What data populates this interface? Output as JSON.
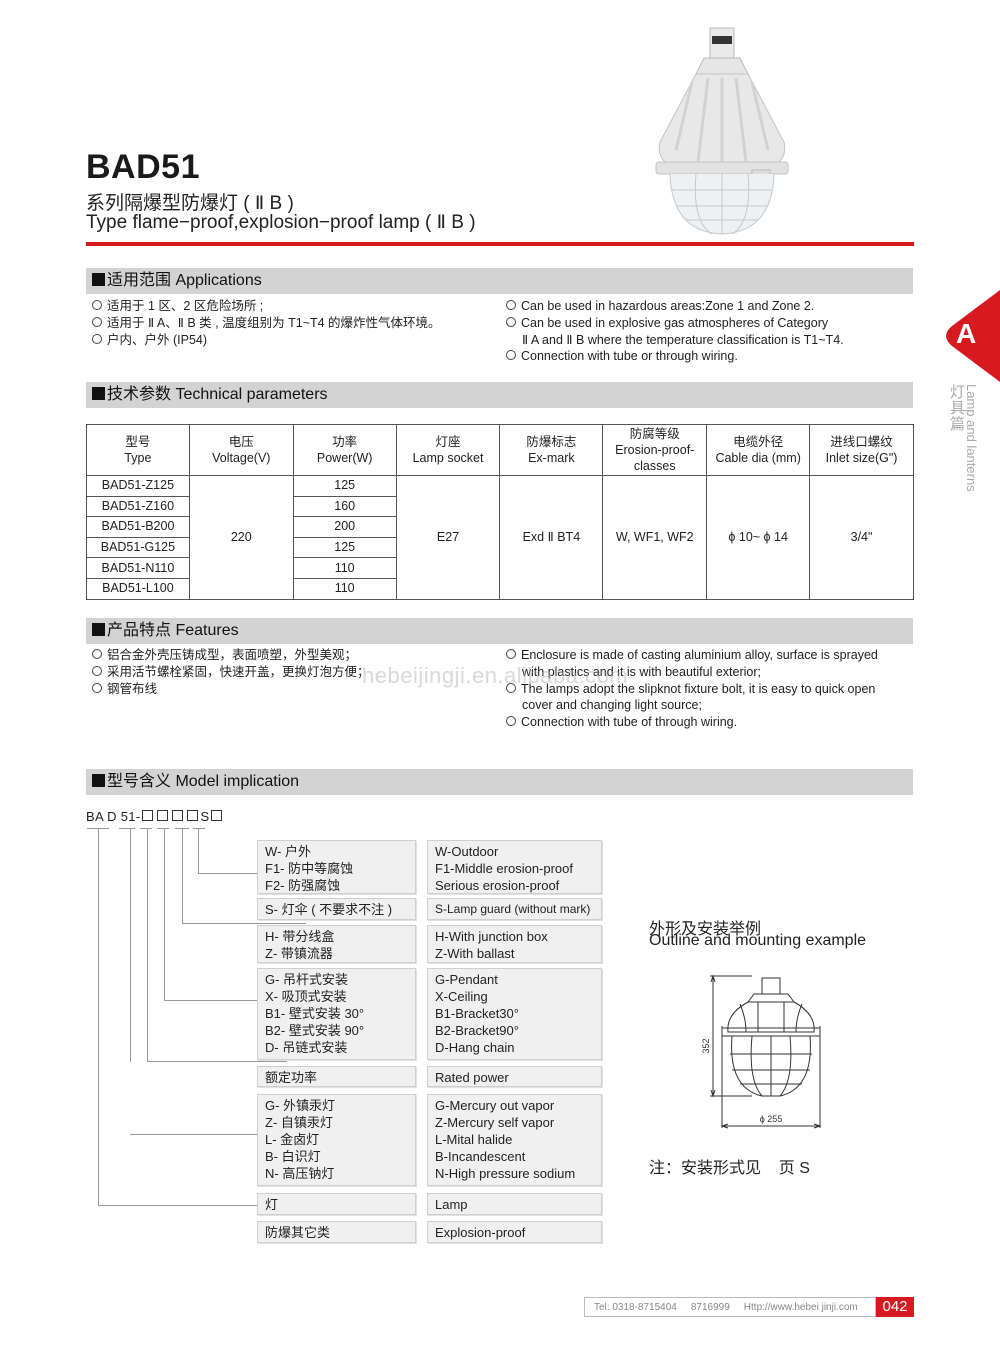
{
  "header": {
    "title": "BAD51",
    "subtitle_cn": "系列隔爆型防爆灯 ( Ⅱ B )",
    "subtitle_en": "Type flame−proof,explosion−proof lamp ( Ⅱ B )",
    "accent_color": "#d71920"
  },
  "side_tab": {
    "letter": "A",
    "label_cn": "灯具篇",
    "label_en": "Lamp and lanterns"
  },
  "applications": {
    "heading": "适用范围 Applications",
    "cn": [
      "适用于 1 区、2 区危险场所 ;",
      "适用于 Ⅱ A、Ⅱ B 类 , 温度组别为 T1~T4 的爆炸性气体环境。",
      "户内、户外 (IP54)"
    ],
    "en": [
      {
        "text": "Can be used in hazardous areas:Zone 1 and Zone 2.",
        "cont": ""
      },
      {
        "text": "Can be used in explosive gas atmospheres of Category",
        "cont": "Ⅱ A and Ⅱ B where the temperature classification is T1~T4."
      },
      {
        "text": "Connection with tube or through wiring.",
        "cont": ""
      }
    ]
  },
  "technical": {
    "heading": "技术参数 Technical parameters",
    "columns": [
      {
        "cn": "型号",
        "en": "Type"
      },
      {
        "cn": "电压",
        "en": "Voltage(V)"
      },
      {
        "cn": "功率",
        "en": "Power(W)"
      },
      {
        "cn": "灯座",
        "en": "Lamp socket"
      },
      {
        "cn": "防爆标志",
        "en": "Ex-mark"
      },
      {
        "cn": "防腐等级",
        "en": "Erosion-proof-classes"
      },
      {
        "cn": "电缆外径",
        "en": "Cable dia (mm)"
      },
      {
        "cn": "进线口螺纹",
        "en": "Inlet size(G\")"
      }
    ],
    "rows": [
      {
        "type": "BAD51-Z125",
        "power": "125"
      },
      {
        "type": "BAD51-Z160",
        "power": "160"
      },
      {
        "type": "BAD51-B200",
        "power": "200"
      },
      {
        "type": "BAD51-G125",
        "power": "125"
      },
      {
        "type": "BAD51-N110",
        "power": "110"
      },
      {
        "type": "BAD51-L100",
        "power": "110"
      }
    ],
    "shared": {
      "voltage": "220",
      "socket": "E27",
      "exmark": "Exd Ⅱ BT4",
      "erosion": "W, WF1, WF2",
      "cable": "ϕ 10~ ϕ 14",
      "inlet": "3/4\""
    }
  },
  "features": {
    "heading": "产品特点 Features",
    "cn": [
      "铝合金外壳压铸成型，表面喷塑，外型美观；",
      "采用活节螺栓紧固，快速开盖，更换灯泡方便；",
      "钢管布线"
    ],
    "en": [
      {
        "text": "Enclosure is made of casting aluminium alloy, surface is sprayed",
        "cont": "with plastics and it is with beautiful exterior;"
      },
      {
        "text": "The lamps adopt the slipknot fixture bolt, it is easy to quick open",
        "cont": "cover and changing light source;"
      },
      {
        "text": "Connection with tube of through wiring.",
        "cont": ""
      }
    ],
    "watermark": "hebeijingji.en.alibaba.com"
  },
  "model": {
    "heading": "型号含义 Model implication",
    "code_prefix": "BA D 51-",
    "code_s": "S",
    "groups": [
      {
        "cn": [
          "W- 户外",
          "F1- 防中等腐蚀",
          "F2- 防强腐蚀"
        ],
        "en": [
          "W-Outdoor",
          "F1-Middle erosion-proof",
          "Serious erosion-proof"
        ]
      },
      {
        "cn": [
          "S- 灯伞 ( 不要求不注 )"
        ],
        "en": [
          "S-Lamp guard (without mark)"
        ]
      },
      {
        "cn": [
          "H- 带分线盒",
          "Z- 带镇流器"
        ],
        "en": [
          "H-With junction box",
          "Z-With ballast"
        ]
      },
      {
        "cn": [
          "G- 吊杆式安装",
          "X- 吸顶式安装",
          "B1- 壁式安装 30°",
          "B2- 壁式安装 90°",
          "D- 吊链式安装"
        ],
        "en": [
          "G-Pendant",
          "X-Ceiling",
          "B1-Bracket30°",
          "B2-Bracket90°",
          "D-Hang chain"
        ]
      },
      {
        "cn": [
          "额定功率"
        ],
        "en": [
          "Rated power"
        ]
      },
      {
        "cn": [
          "G- 外镇汞灯",
          "Z- 自镇汞灯",
          "L- 金卤灯",
          "B- 白识灯",
          "N- 高压钠灯"
        ],
        "en": [
          "G-Mercury out vapor",
          "Z-Mercury self vapor",
          "L-Mital halide",
          "B-Incandescent",
          "N-High pressure sodium"
        ]
      },
      {
        "cn": [
          "灯"
        ],
        "en": [
          "Lamp"
        ]
      },
      {
        "cn": [
          "防爆其它类"
        ],
        "en": [
          "Explosion-proof"
        ]
      }
    ]
  },
  "outline": {
    "title_cn": "外形及安装举例",
    "title_en": "Outline and mounting example",
    "height_dim": "352",
    "width_dim": "ϕ 255",
    "note": "注：安装形式见    页 S"
  },
  "footer": {
    "tel": "Tel: 0318-8715404",
    "tel2": "8716999",
    "url": "Http://www.hebei jinji.com",
    "page": "042"
  }
}
